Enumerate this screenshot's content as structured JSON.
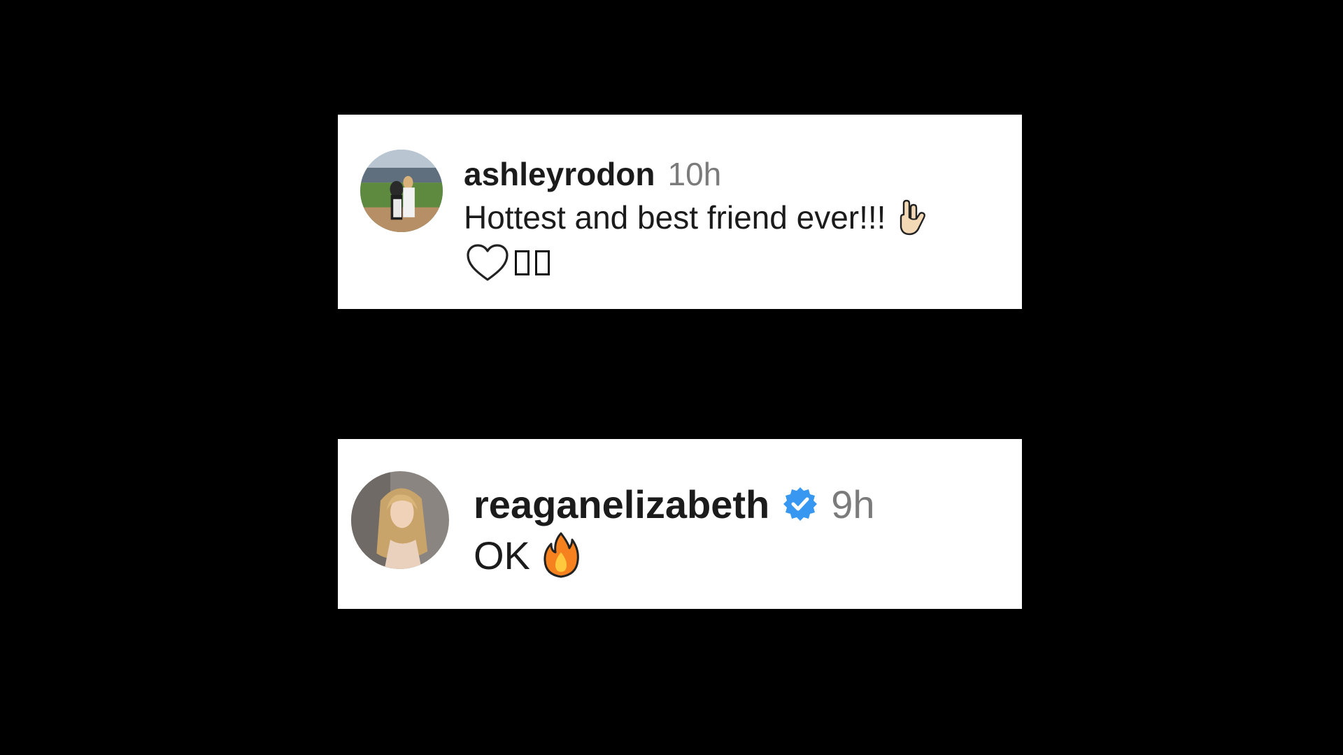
{
  "comments": [
    {
      "username": "ashleyrodon",
      "time": "10h",
      "text": "Hottest and best friend ever!!!",
      "emojis": [
        "love-you-hand-gesture",
        "white-heart",
        "unrendered-glyph",
        "unrendered-glyph"
      ],
      "verified": false
    },
    {
      "username": "reaganelizabeth",
      "time": "9h",
      "text": "OK",
      "emojis": [
        "fire"
      ],
      "verified": true,
      "verified_color": "#3897f0"
    }
  ],
  "colors": {
    "background": "#000000",
    "card": "#ffffff",
    "username": "#1b1b1b",
    "timestamp": "#7b7b7b"
  }
}
